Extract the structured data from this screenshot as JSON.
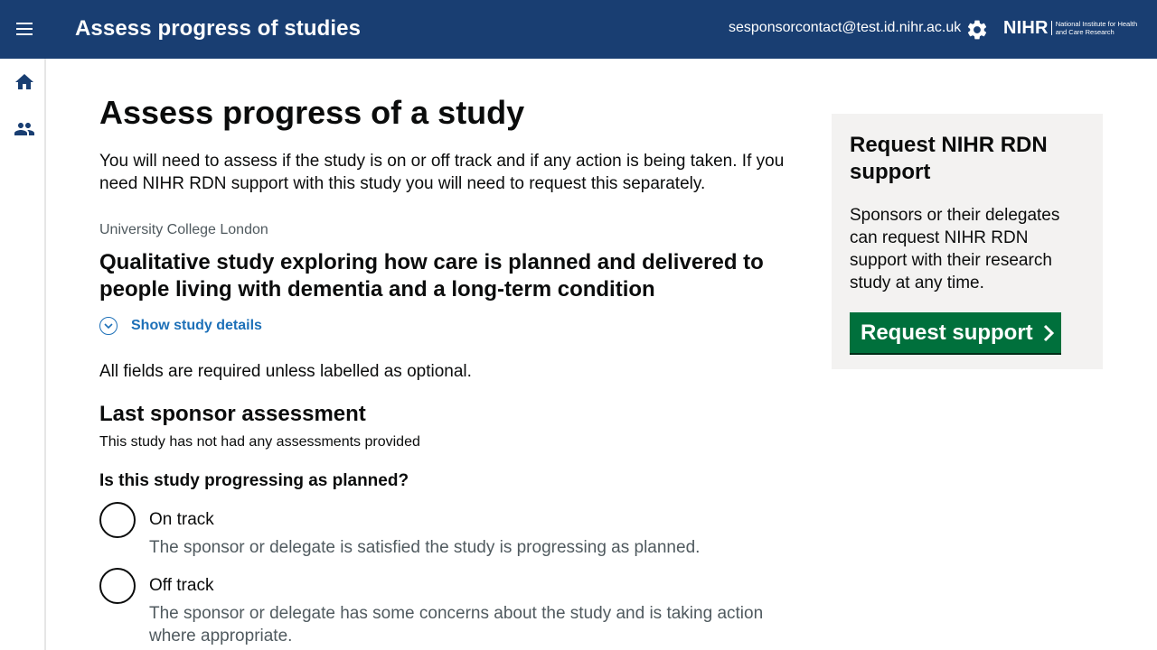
{
  "header": {
    "app_title": "Assess progress of studies",
    "user_email": "sesponsorcontact@test.id.nihr.ac.uk",
    "logo_mark": "NIHR",
    "logo_text": "National Institute for Health and Care Research",
    "icons": [
      "menu-icon",
      "gear-icon"
    ]
  },
  "side_nav": {
    "items": [
      {
        "icon": "home-icon"
      },
      {
        "icon": "people-icon"
      }
    ]
  },
  "main": {
    "title": "Assess progress of a study",
    "intro": "You will need to assess if the study is on or off track and if any action is being taken. If you need NIHR RDN support with this study you will need to request this separately.",
    "organisation": "University College London",
    "study_title": "Qualitative study exploring how care is planned and delivered to people living with dementia and a long-term condition",
    "show_details_label": "Show study details",
    "required_note": "All fields are required unless labelled as optional.",
    "last_assessment_heading": "Last sponsor assessment",
    "last_assessment_text": "This study has not had any assessments provided",
    "question": "Is this study progressing as planned?",
    "options": [
      {
        "label": "On track",
        "hint": "The sponsor or delegate is satisfied the study is progressing as planned."
      },
      {
        "label": "Off track",
        "hint": "The sponsor or delegate has some concerns about the study and is taking action where appropriate."
      }
    ]
  },
  "aside": {
    "title": "Request NIHR RDN support",
    "body": "Sponsors or their delegates can request NIHR RDN support with their research study at any time.",
    "button_label": "Request support"
  },
  "colors": {
    "header_bg": "#193e72",
    "link": "#1d70b8",
    "button_green": "#00703c",
    "panel_bg": "#f3f2f1",
    "hint_text": "#505a5f"
  }
}
